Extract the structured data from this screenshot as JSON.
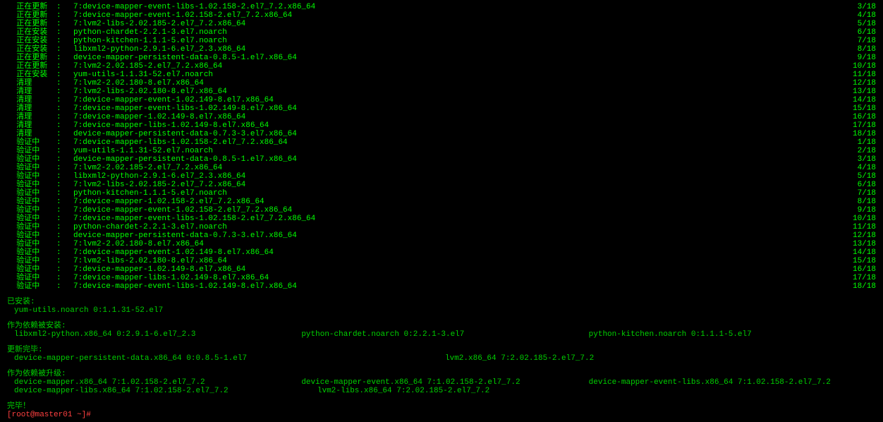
{
  "progress": [
    {
      "label": "正在更新",
      "pkg": "7:device-mapper-event-libs-1.02.158-2.el7_7.2.x86_64",
      "n": 3,
      "t": 18
    },
    {
      "label": "正在更新",
      "pkg": "7:device-mapper-event-1.02.158-2.el7_7.2.x86_64",
      "n": 4,
      "t": 18
    },
    {
      "label": "正在更新",
      "pkg": "7:lvm2-libs-2.02.185-2.el7_7.2.x86_64",
      "n": 5,
      "t": 18
    },
    {
      "label": "正在安装",
      "pkg": "python-chardet-2.2.1-3.el7.noarch",
      "n": 6,
      "t": 18
    },
    {
      "label": "正在安装",
      "pkg": "python-kitchen-1.1.1-5.el7.noarch",
      "n": 7,
      "t": 18
    },
    {
      "label": "正在安装",
      "pkg": "libxml2-python-2.9.1-6.el7_2.3.x86_64",
      "n": 8,
      "t": 18
    },
    {
      "label": "正在更新",
      "pkg": "device-mapper-persistent-data-0.8.5-1.el7.x86_64",
      "n": 9,
      "t": 18
    },
    {
      "label": "正在更新",
      "pkg": "7:lvm2-2.02.185-2.el7_7.2.x86_64",
      "n": 10,
      "t": 18
    },
    {
      "label": "正在安装",
      "pkg": "yum-utils-1.1.31-52.el7.noarch",
      "n": 11,
      "t": 18
    },
    {
      "label": "清理",
      "pkg": "7:lvm2-2.02.180-8.el7.x86_64",
      "n": 12,
      "t": 18
    },
    {
      "label": "清理",
      "pkg": "7:lvm2-libs-2.02.180-8.el7.x86_64",
      "n": 13,
      "t": 18
    },
    {
      "label": "清理",
      "pkg": "7:device-mapper-event-1.02.149-8.el7.x86_64",
      "n": 14,
      "t": 18
    },
    {
      "label": "清理",
      "pkg": "7:device-mapper-event-libs-1.02.149-8.el7.x86_64",
      "n": 15,
      "t": 18
    },
    {
      "label": "清理",
      "pkg": "7:device-mapper-1.02.149-8.el7.x86_64",
      "n": 16,
      "t": 18
    },
    {
      "label": "清理",
      "pkg": "7:device-mapper-libs-1.02.149-8.el7.x86_64",
      "n": 17,
      "t": 18
    },
    {
      "label": "清理",
      "pkg": "device-mapper-persistent-data-0.7.3-3.el7.x86_64",
      "n": 18,
      "t": 18
    },
    {
      "label": "验证中",
      "pkg": "7:device-mapper-libs-1.02.158-2.el7_7.2.x86_64",
      "n": 1,
      "t": 18
    },
    {
      "label": "验证中",
      "pkg": "yum-utils-1.1.31-52.el7.noarch",
      "n": 2,
      "t": 18
    },
    {
      "label": "验证中",
      "pkg": "device-mapper-persistent-data-0.8.5-1.el7.x86_64",
      "n": 3,
      "t": 18
    },
    {
      "label": "验证中",
      "pkg": "7:lvm2-2.02.185-2.el7_7.2.x86_64",
      "n": 4,
      "t": 18
    },
    {
      "label": "验证中",
      "pkg": "libxml2-python-2.9.1-6.el7_2.3.x86_64",
      "n": 5,
      "t": 18
    },
    {
      "label": "验证中",
      "pkg": "7:lvm2-libs-2.02.185-2.el7_7.2.x86_64",
      "n": 6,
      "t": 18
    },
    {
      "label": "验证中",
      "pkg": "python-kitchen-1.1.1-5.el7.noarch",
      "n": 7,
      "t": 18
    },
    {
      "label": "验证中",
      "pkg": "7:device-mapper-1.02.158-2.el7_7.2.x86_64",
      "n": 8,
      "t": 18
    },
    {
      "label": "验证中",
      "pkg": "7:device-mapper-event-1.02.158-2.el7_7.2.x86_64",
      "n": 9,
      "t": 18
    },
    {
      "label": "验证中",
      "pkg": "7:device-mapper-event-libs-1.02.158-2.el7_7.2.x86_64",
      "n": 10,
      "t": 18
    },
    {
      "label": "验证中",
      "pkg": "python-chardet-2.2.1-3.el7.noarch",
      "n": 11,
      "t": 18
    },
    {
      "label": "验证中",
      "pkg": "device-mapper-persistent-data-0.7.3-3.el7.x86_64",
      "n": 12,
      "t": 18
    },
    {
      "label": "验证中",
      "pkg": "7:lvm2-2.02.180-8.el7.x86_64",
      "n": 13,
      "t": 18
    },
    {
      "label": "验证中",
      "pkg": "7:device-mapper-event-1.02.149-8.el7.x86_64",
      "n": 14,
      "t": 18
    },
    {
      "label": "验证中",
      "pkg": "7:lvm2-libs-2.02.180-8.el7.x86_64",
      "n": 15,
      "t": 18
    },
    {
      "label": "验证中",
      "pkg": "7:device-mapper-1.02.149-8.el7.x86_64",
      "n": 16,
      "t": 18
    },
    {
      "label": "验证中",
      "pkg": "7:device-mapper-libs-1.02.149-8.el7.x86_64",
      "n": 17,
      "t": 18
    },
    {
      "label": "验证中",
      "pkg": "7:device-mapper-event-libs-1.02.149-8.el7.x86_64",
      "n": 18,
      "t": 18
    }
  ],
  "installed_header": "已安装:",
  "installed": [
    "yum-utils.noarch 0:1.1.31-52.el7"
  ],
  "dep_installed_header": "作为依赖被安装:",
  "dep_installed": [
    "libxml2-python.x86_64 0:2.9.1-6.el7_2.3",
    "python-chardet.noarch 0:2.2.1-3.el7",
    "python-kitchen.noarch 0:1.1.1-5.el7"
  ],
  "updated_header": "更新完毕:",
  "updated": [
    "device-mapper-persistent-data.x86_64 0:0.8.5-1.el7",
    "lvm2.x86_64 7:2.02.185-2.el7_7.2"
  ],
  "dep_updated_header": "作为依赖被升级:",
  "dep_updated": [
    "device-mapper.x86_64 7:1.02.158-2.el7_7.2",
    "device-mapper-event.x86_64 7:1.02.158-2.el7_7.2",
    "device-mapper-event-libs.x86_64 7:1.02.158-2.el7_7.2",
    "device-mapper-libs.x86_64 7:1.02.158-2.el7_7.2",
    "lvm2-libs.x86_64 7:2.02.185-2.el7_7.2"
  ],
  "done": "完毕！",
  "prompt_user": "[root@master01 ~]#",
  "cursor": " "
}
